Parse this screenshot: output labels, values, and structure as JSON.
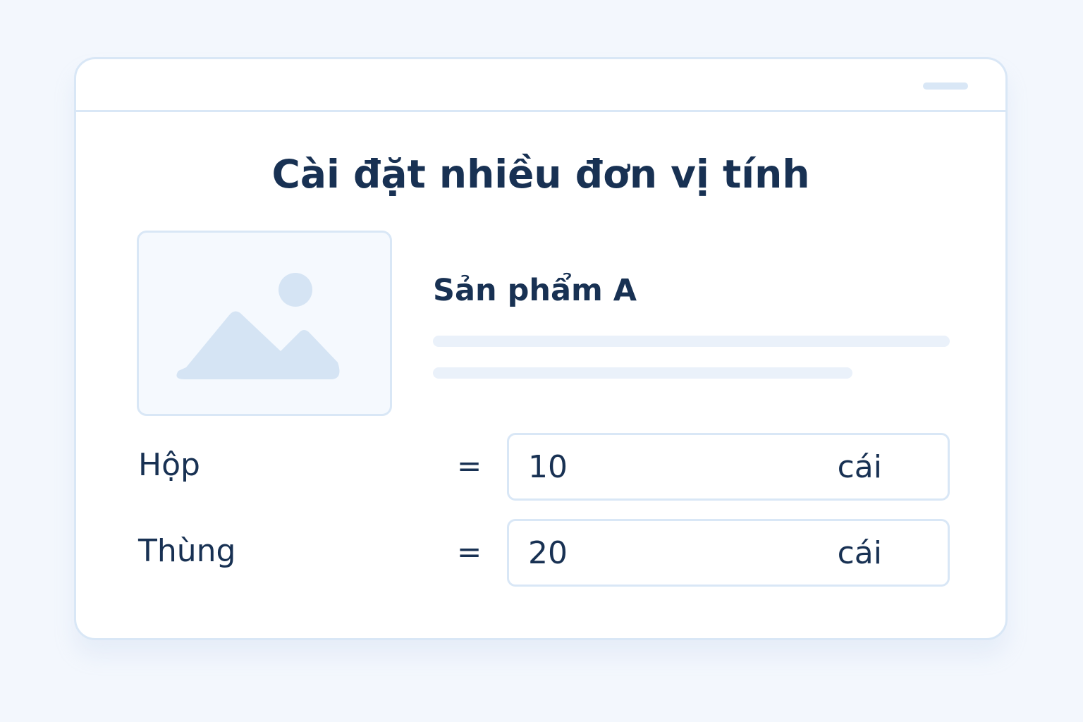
{
  "dialog": {
    "title": "Cài đặt nhiều đơn vị tính",
    "colors": {
      "background": "#f3f7fd",
      "border": "#d9e7f6",
      "text": "#183153",
      "placeholder_fill": "#d5e4f4"
    }
  },
  "product": {
    "name": "Sản phẩm A",
    "image_icon": "image-placeholder-icon"
  },
  "units": [
    {
      "label": "Hộp",
      "equals": "=",
      "quantity": "10",
      "base_unit": "cái"
    },
    {
      "label": "Thùng",
      "equals": "=",
      "quantity": "20",
      "base_unit": "cái"
    }
  ]
}
